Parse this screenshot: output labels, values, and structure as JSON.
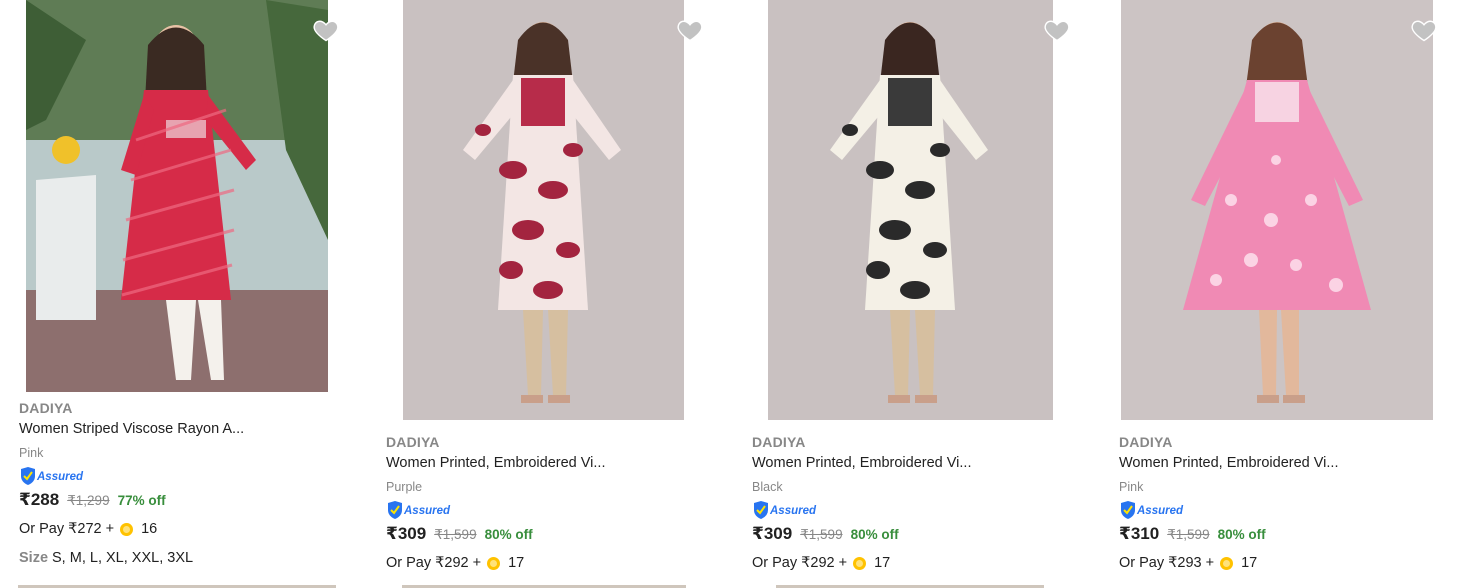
{
  "products": [
    {
      "brand": "DADIYA",
      "title": "Women Striped Viscose Rayon A...",
      "color": "Pink",
      "assured": "Assured",
      "price": "₹288",
      "mrp": "₹1,299",
      "discount": "77% off",
      "or_pay": "Or Pay ₹272 +",
      "coins": "16",
      "size_label": "Size",
      "sizes": "S, M, L, XL, XXL, 3XL",
      "image_icon": "product-image",
      "dress_color": "#d62b48"
    },
    {
      "brand": "DADIYA",
      "title": "Women Printed, Embroidered Vi...",
      "color": "Purple",
      "assured": "Assured",
      "price": "₹309",
      "mrp": "₹1,599",
      "discount": "80% off",
      "or_pay": "Or Pay ₹292 +",
      "coins": "17",
      "image_icon": "product-image",
      "dress_color": "#a3243f"
    },
    {
      "brand": "DADIYA",
      "title": "Women Printed, Embroidered Vi...",
      "color": "Black",
      "assured": "Assured",
      "price": "₹309",
      "mrp": "₹1,599",
      "discount": "80% off",
      "or_pay": "Or Pay ₹292 +",
      "coins": "17",
      "image_icon": "product-image",
      "dress_color": "#2a2a2a"
    },
    {
      "brand": "DADIYA",
      "title": "Women Printed, Embroidered Vi...",
      "color": "Pink",
      "assured": "Assured",
      "price": "₹310",
      "mrp": "₹1,599",
      "discount": "80% off",
      "or_pay": "Or Pay ₹293 +",
      "coins": "17",
      "image_icon": "product-image",
      "dress_color": "#f08ab4"
    }
  ],
  "colors": {
    "discount_green": "#388e3c",
    "muted_grey": "#878787",
    "assured_blue": "#2874f0",
    "coin_yellow": "#ffc200",
    "wishlist_grey": "#c2c2c2"
  }
}
